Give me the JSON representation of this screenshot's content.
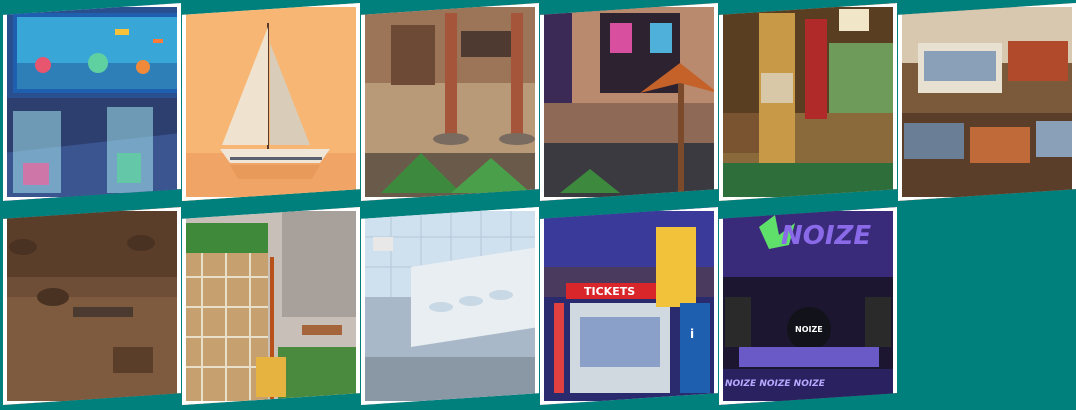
{
  "sheet": {
    "background_color": "#00807d",
    "tile_border_color": "#ffffff"
  },
  "tiles": [
    {
      "scene": "aquarium",
      "row": 1,
      "col": 1
    },
    {
      "scene": "sailboat-sunset",
      "row": 1,
      "col": 2
    },
    {
      "scene": "courtyard-palms",
      "row": 1,
      "col": 3
    },
    {
      "scene": "street-shop-palm",
      "row": 1,
      "col": 4
    },
    {
      "scene": "hotel-lobby",
      "row": 1,
      "col": 5
    },
    {
      "scene": "fish-market",
      "row": 1,
      "col": 6
    },
    {
      "scene": "wooden-dock",
      "row": 2,
      "col": 1
    },
    {
      "scene": "school-yard-climbing-net",
      "row": 2,
      "col": 2
    },
    {
      "scene": "restroom-sinks",
      "row": 2,
      "col": 3
    },
    {
      "scene": "ticket-booth",
      "row": 2,
      "col": 4
    },
    {
      "scene": "concert-stage",
      "row": 2,
      "col": 5
    }
  ],
  "signs": {
    "tickets": "TICKETS",
    "info": "i",
    "stage_banner": "NOIZE",
    "drum_logo": "NOIZE",
    "stage_skirt": "NOIZE NOIZE NOIZE"
  }
}
